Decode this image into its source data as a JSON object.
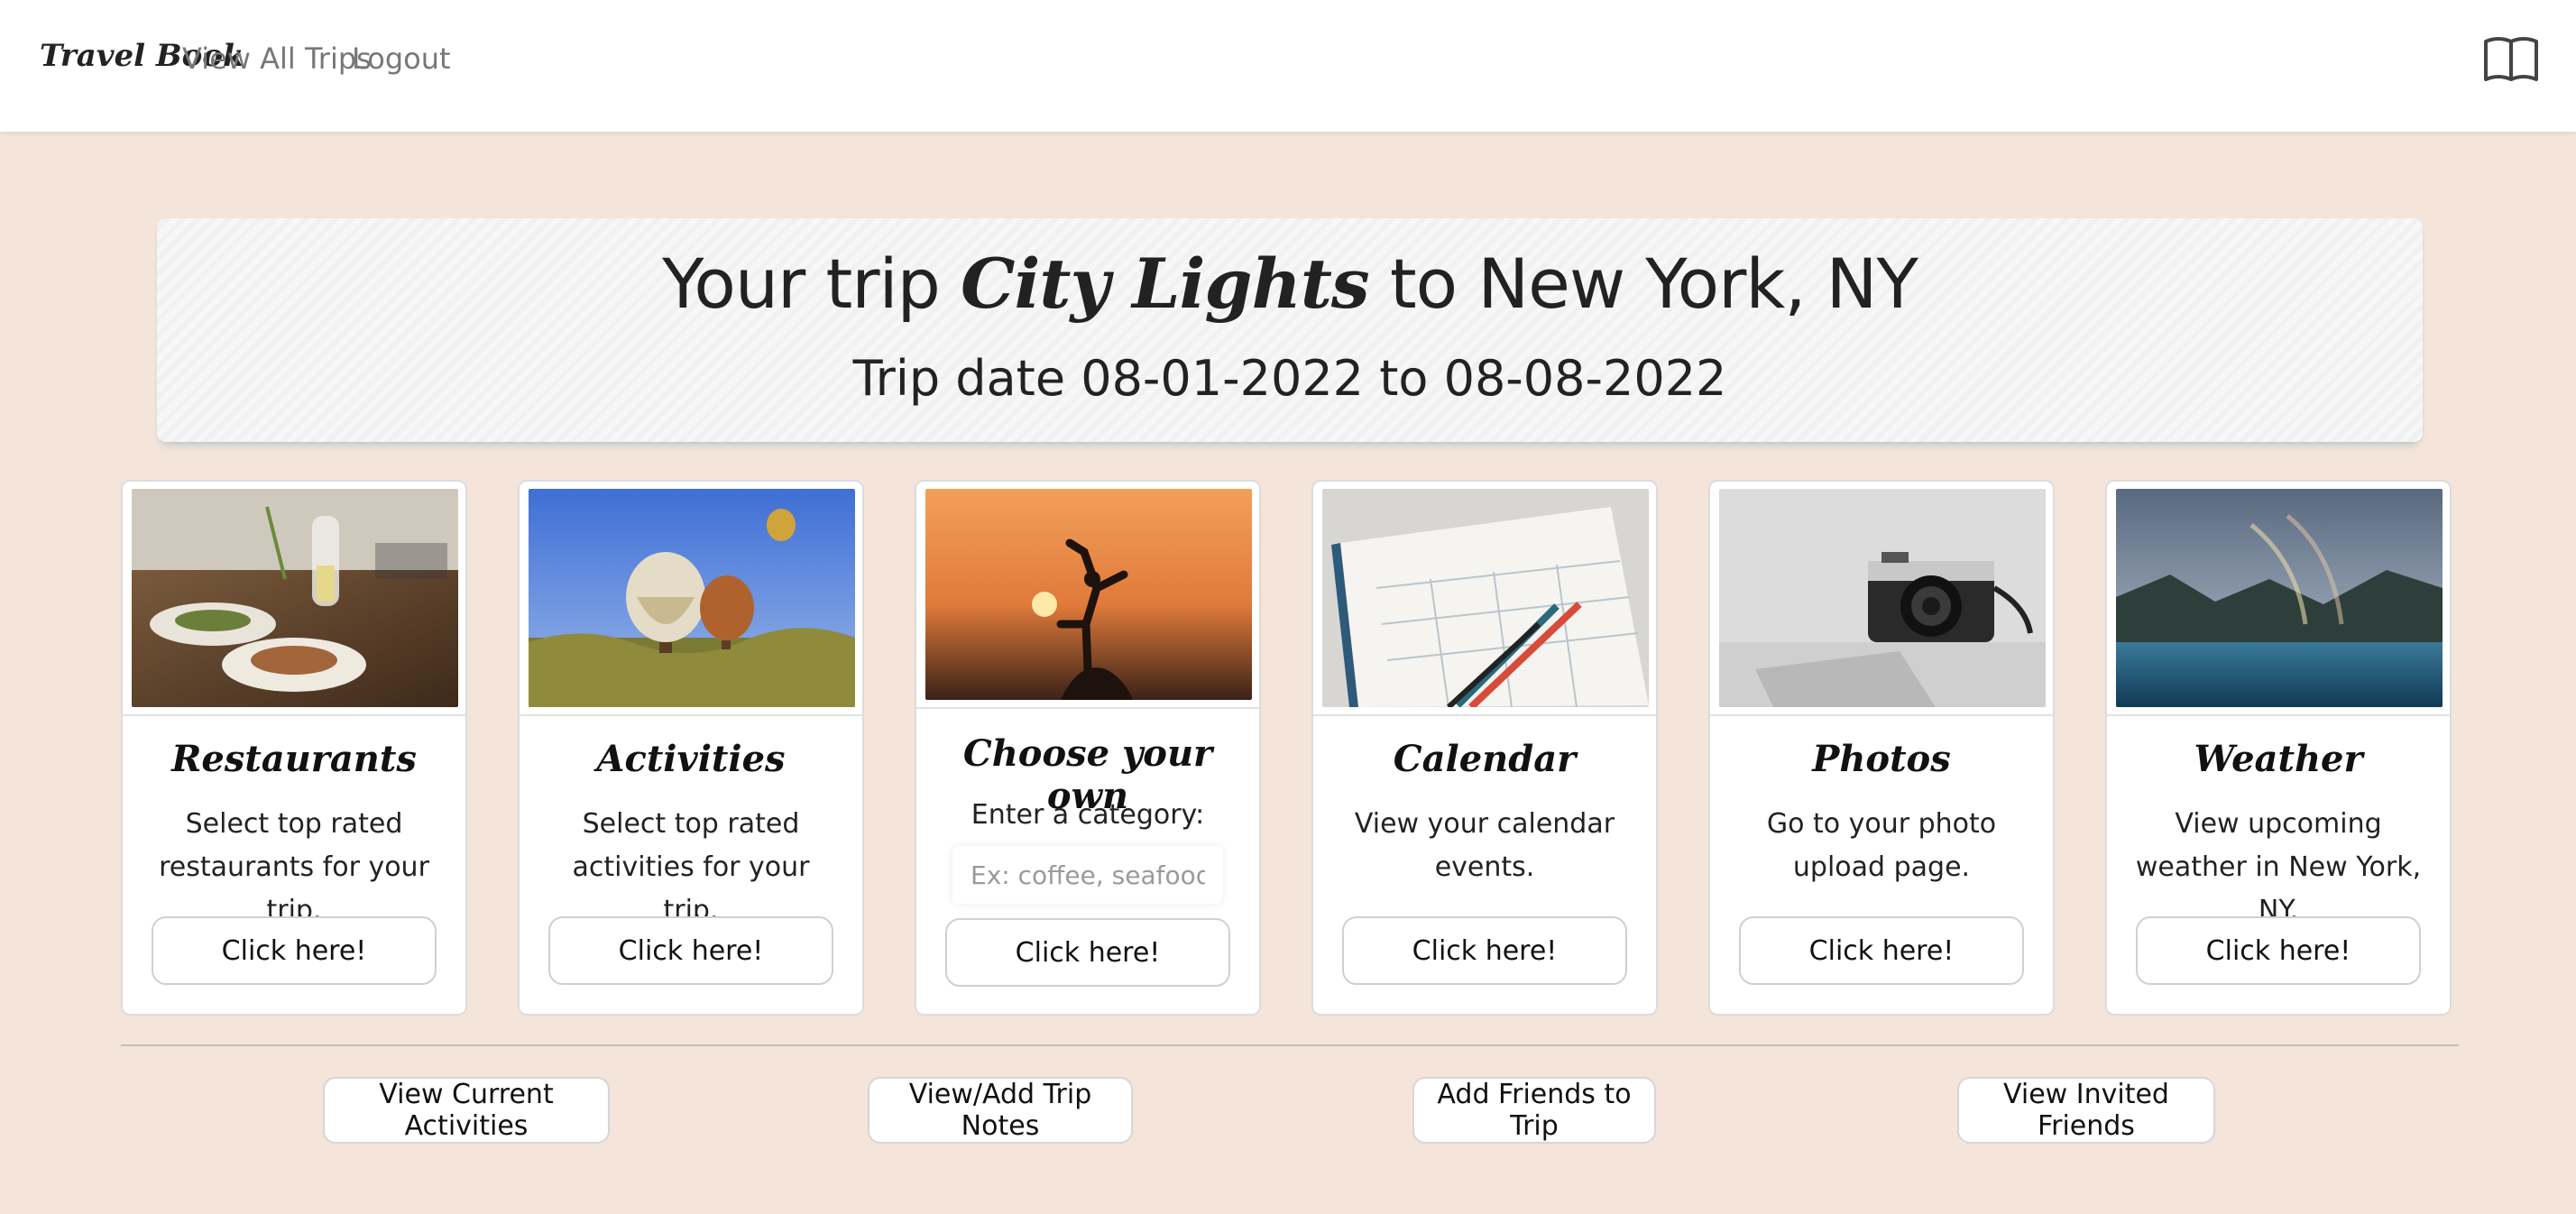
{
  "nav": {
    "brand": "Travel Book",
    "links": [
      "View All Trips",
      "Logout"
    ],
    "icon": "book-icon"
  },
  "banner": {
    "prefix": "Your trip ",
    "trip_name": "City Lights",
    "suffix": " to New York, NY",
    "date_line": "Trip date 08-01-2022 to 08-08-2022"
  },
  "cards": [
    {
      "title": "Restaurants",
      "text": "Select top rated restaurants for your trip.",
      "button": "Click here!",
      "image": "restaurant-photo"
    },
    {
      "title": "Activities",
      "text": "Select top rated activities for your trip.",
      "button": "Click here!",
      "image": "hot-air-balloons-photo"
    },
    {
      "title": "Choose your own",
      "text": "Enter a category:",
      "placeholder": "Ex: coffee, seafood, etc",
      "button": "Click here!",
      "image": "sunset-silhouette-photo"
    },
    {
      "title": "Calendar",
      "text": "View your calendar events.",
      "button": "Click here!",
      "image": "monthly-planner-photo"
    },
    {
      "title": "Photos",
      "text": "Go to your photo upload page.",
      "button": "Click here!",
      "image": "camera-photo"
    },
    {
      "title": "Weather",
      "text": "View upcoming weather in New York, NY.",
      "button": "Click here!",
      "image": "rainbow-lake-photo"
    }
  ],
  "bottom_buttons": [
    "View Current Activities",
    "View/Add Trip Notes",
    "Add Friends to Trip",
    "View Invited Friends"
  ],
  "colors": {
    "background": "#f5e4da",
    "navbar": "#ffffff",
    "card_border": "#dcdcdc",
    "banner_shadow": "#78aabe"
  }
}
